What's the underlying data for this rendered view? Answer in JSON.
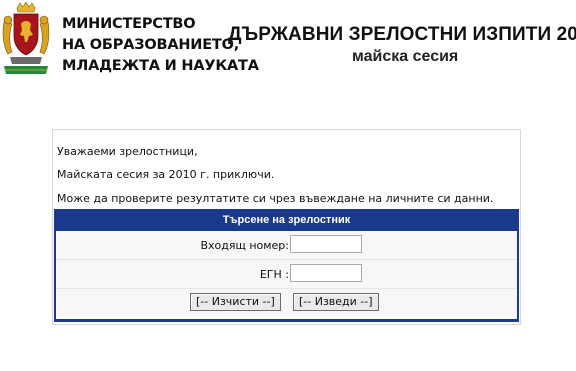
{
  "header": {
    "ministry_lines": [
      "МИНИСТЕРСТВО",
      "НА ОБРАЗОВАНИЕТО,",
      "МЛАДЕЖТА И НАУКАТА"
    ],
    "exam_title": "ДЪРЖАВНИ ЗРЕЛОСТНИ ИЗПИТИ 20",
    "session": "майска сесия",
    "crest_colors": {
      "shield": "#a8141c",
      "lion": "#e8b52a",
      "supporters": "#d9a21f",
      "ribbon": "#1e8a3a"
    }
  },
  "intro": {
    "greeting": "Уважаеми зрелостници,",
    "line2": "Майската сесия за 2010 г. приключи.",
    "line3": "Може да проверите резултатите си чрез въвеждане на личните си данни."
  },
  "form": {
    "title": "Търсене на зрелостник",
    "incoming_label": "Входящ номер:",
    "incoming_value": "",
    "egn_label": "ЕГН :",
    "egn_value": "",
    "clear_button": "[-- Изчисти --]",
    "submit_button": "[-- Изведи --]",
    "frame_color": "#1a3a8e"
  }
}
